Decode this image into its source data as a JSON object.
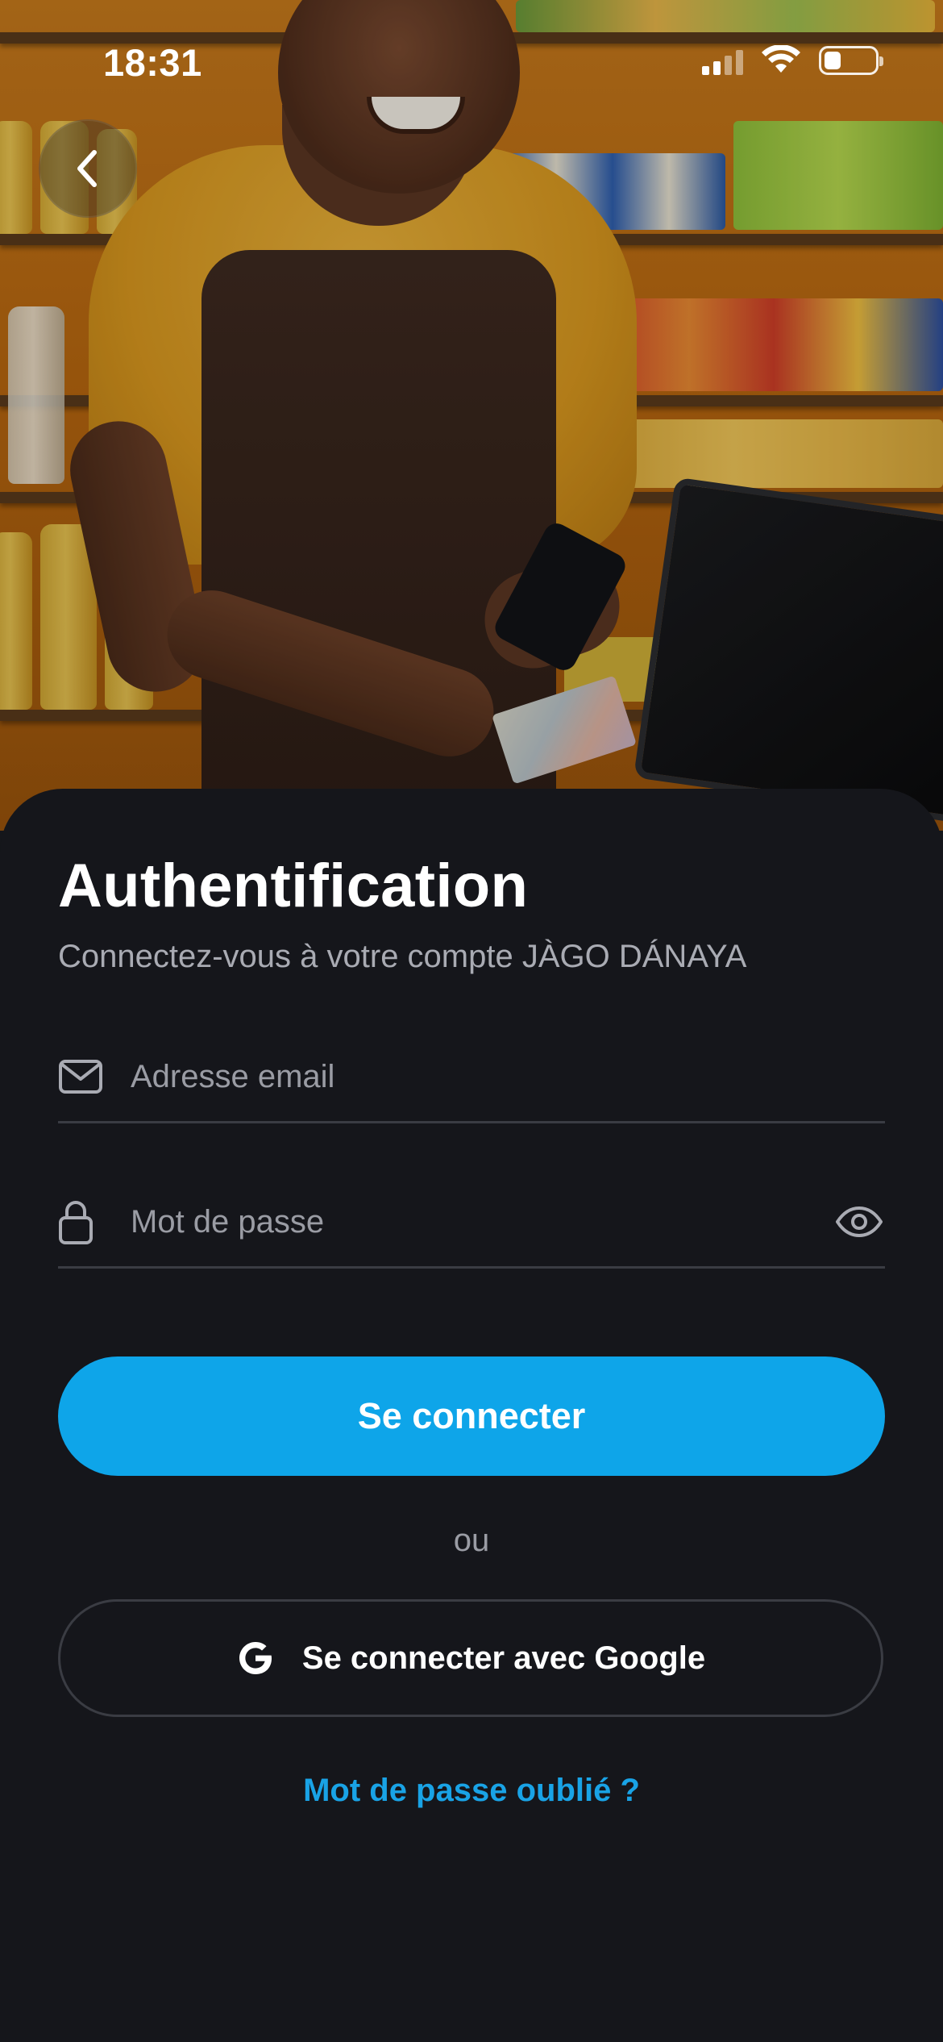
{
  "status_bar": {
    "time": "18:31",
    "icons": [
      "cellular-signal-icon",
      "wifi-icon",
      "battery-icon"
    ],
    "battery_level": 0.35
  },
  "hero": {
    "image": "shopkeeper-at-counter-photo"
  },
  "navigation": {
    "back_icon": "chevron-left-icon"
  },
  "auth": {
    "title": "Authentification",
    "subtitle": "Connectez-vous à votre compte JÀGO DÁNAYA",
    "email": {
      "icon": "envelope-icon",
      "placeholder": "Adresse email",
      "value": ""
    },
    "password": {
      "icon": "lock-icon",
      "placeholder": "Mot de passe",
      "value": "",
      "toggle_icon": "eye-icon"
    },
    "login_button": "Se connecter",
    "separator": "ou",
    "google_button": {
      "icon": "google-g-icon",
      "label": "Se connecter avec Google"
    },
    "forgot_password": "Mot de passe oublié ?"
  },
  "colors": {
    "background": "#15161b",
    "primary": "#0ea5e9",
    "link": "#19a3e6",
    "divider": "#3a3c43",
    "muted_text": "#9a9ca4"
  }
}
